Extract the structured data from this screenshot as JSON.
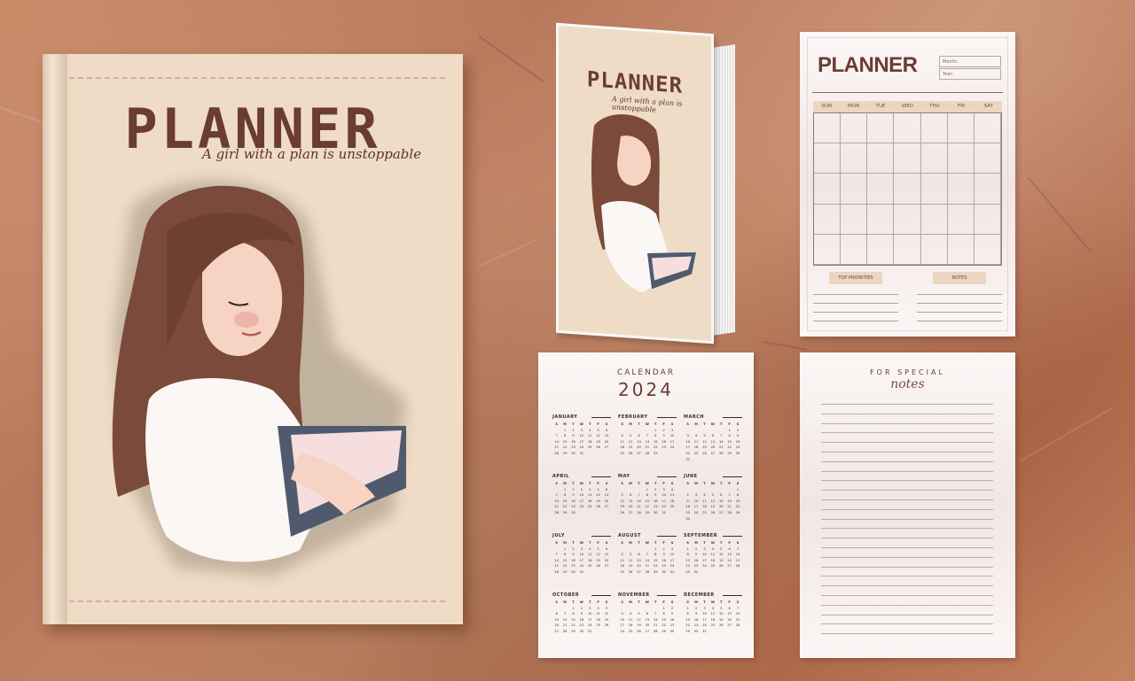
{
  "cover": {
    "title": "PLANNER",
    "subtitle": "A girl with a plan is unstoppable"
  },
  "monthly_page": {
    "title": "PLANNER",
    "month_label": "Month:",
    "year_label": "Year:",
    "weekdays": [
      "SUN",
      "MON",
      "TUE",
      "WED",
      "THU",
      "FRI",
      "SAT"
    ],
    "top_priorities_label": "TOP PRIORITIES",
    "notes_label": "NOTES"
  },
  "calendar_page": {
    "heading": "CALENDAR",
    "year": "2024",
    "weekday_initials": [
      "S",
      "M",
      "T",
      "W",
      "T",
      "F",
      "S"
    ],
    "months": [
      {
        "name": "JANUARY",
        "start": 1,
        "days": 31
      },
      {
        "name": "FEBRUARY",
        "start": 4,
        "days": 29
      },
      {
        "name": "MARCH",
        "start": 5,
        "days": 31
      },
      {
        "name": "APRIL",
        "start": 1,
        "days": 30
      },
      {
        "name": "MAY",
        "start": 3,
        "days": 31
      },
      {
        "name": "JUNE",
        "start": 6,
        "days": 30
      },
      {
        "name": "JULY",
        "start": 1,
        "days": 31
      },
      {
        "name": "AUGUST",
        "start": 4,
        "days": 31
      },
      {
        "name": "SEPTEMBER",
        "start": 0,
        "days": 30
      },
      {
        "name": "OCTOBER",
        "start": 2,
        "days": 31
      },
      {
        "name": "NOVEMBER",
        "start": 5,
        "days": 30
      },
      {
        "name": "DECEMBER",
        "start": 0,
        "days": 31
      }
    ]
  },
  "notes_page": {
    "heading": "FOR SPECIAL",
    "script_title": "notes"
  }
}
